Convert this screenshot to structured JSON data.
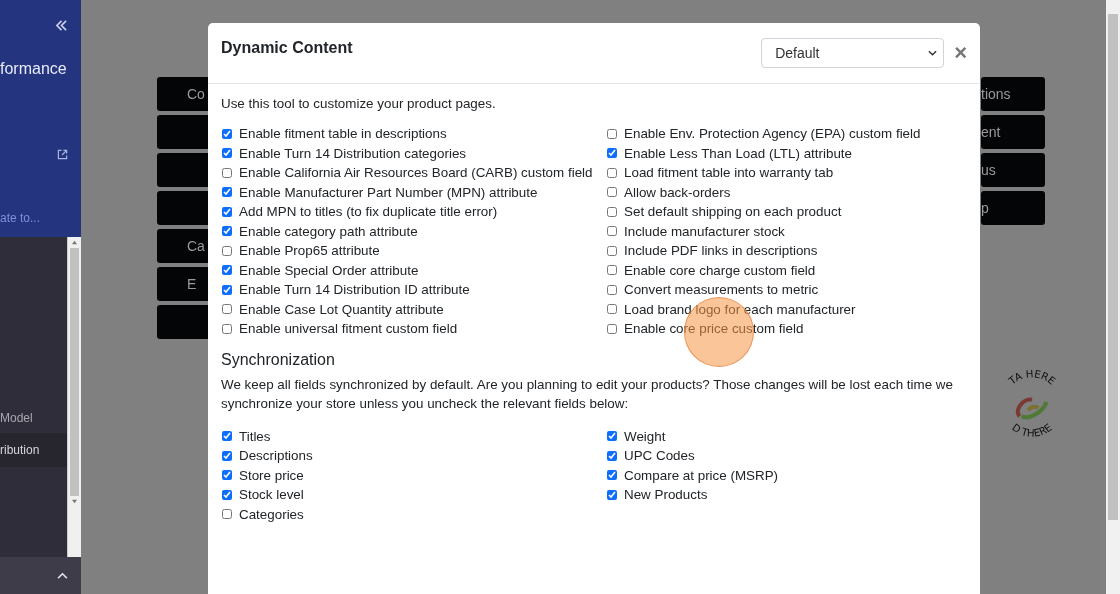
{
  "sidebar": {
    "title": "formance",
    "nav_placeholder": "ate to...",
    "items": [
      {
        "label": "Model",
        "selected": false
      },
      {
        "label": "ribution",
        "selected": true
      }
    ]
  },
  "background_buttons": {
    "left": [
      {
        "kind": "labeled",
        "label": "Co"
      },
      {
        "kind": "blank"
      },
      {
        "kind": "blank"
      },
      {
        "kind": "blank"
      },
      {
        "kind": "labeled",
        "label": "Ca"
      },
      {
        "kind": "labeled",
        "label": "E"
      },
      {
        "kind": "blank"
      }
    ],
    "right": [
      {
        "kind": "labeled",
        "label": "tions"
      },
      {
        "kind": "labeled",
        "label": "ent"
      },
      {
        "kind": "labeled",
        "label": "us"
      },
      {
        "kind": "labeled",
        "label": "p"
      }
    ]
  },
  "logo": {
    "top_text": "TA HERE",
    "bottom_text": "D THERE"
  },
  "modal": {
    "title": "Dynamic Content",
    "select_value": "Default",
    "close": "×",
    "intro": "Use this tool to customize your product pages.",
    "options": [
      {
        "label": "Enable fitment table in descriptions",
        "checked": true
      },
      {
        "label": "Enable Turn 14 Distribution categories",
        "checked": true
      },
      {
        "label": "Enable California Air Resources Board (CARB) custom field",
        "checked": false
      },
      {
        "label": "Enable Manufacturer Part Number (MPN) attribute",
        "checked": true
      },
      {
        "label": "Add MPN to titles (to fix duplicate title error)",
        "checked": true
      },
      {
        "label": "Enable category path attribute",
        "checked": true
      },
      {
        "label": "Enable Prop65 attribute",
        "checked": false
      },
      {
        "label": "Enable Special Order attribute",
        "checked": true
      },
      {
        "label": "Enable Turn 14 Distribution ID attribute",
        "checked": true
      },
      {
        "label": "Enable Case Lot Quantity attribute",
        "checked": false
      },
      {
        "label": "Enable universal fitment custom field",
        "checked": false
      },
      {
        "label": "Enable Env. Protection Agency (EPA) custom field",
        "checked": false
      },
      {
        "label": "Enable Less Than Load (LTL) attribute",
        "checked": true
      },
      {
        "label": "Load fitment table into warranty tab",
        "checked": false
      },
      {
        "label": "Allow back-orders",
        "checked": false
      },
      {
        "label": "Set default shipping on each product",
        "checked": false
      },
      {
        "label": "Include manufacturer stock",
        "checked": false
      },
      {
        "label": "Include PDF links in descriptions",
        "checked": false
      },
      {
        "label": "Enable core charge custom field",
        "checked": false
      },
      {
        "label": "Convert measurements to metric",
        "checked": false
      },
      {
        "label": "Load brand logo for each manufacturer",
        "checked": false
      },
      {
        "label": "Enable core price custom field",
        "checked": false
      }
    ],
    "sync_heading": "Synchronization",
    "sync_text": "We keep all fields synchronized by default. Are you planning to edit your products? Those changes will be lost each time we synchronize your store unless you uncheck the relevant fields below:",
    "sync_fields": [
      {
        "label": "Titles",
        "checked": true
      },
      {
        "label": "Descriptions",
        "checked": true
      },
      {
        "label": "Store price",
        "checked": true
      },
      {
        "label": "Stock level",
        "checked": true
      },
      {
        "label": "Categories",
        "checked": false
      },
      {
        "label": "Weight",
        "checked": true
      },
      {
        "label": "UPC Codes",
        "checked": true
      },
      {
        "label": "Compare at price (MSRP)",
        "checked": true
      },
      {
        "label": "New Products",
        "checked": true
      }
    ]
  }
}
